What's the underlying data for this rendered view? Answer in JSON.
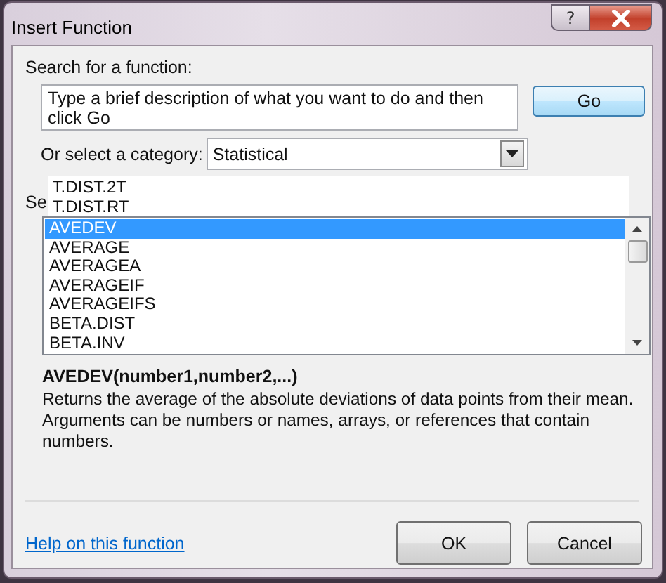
{
  "window": {
    "title": "Insert Function",
    "help_label": "?"
  },
  "search": {
    "label": "Search for a function:",
    "value": "Type a brief description of what you want to do and then click Go",
    "button": "Go"
  },
  "category": {
    "label": "Or select a category:",
    "value": "Statistical"
  },
  "category_popup": {
    "items": [
      "T.DIST.2T",
      "T.DIST.RT"
    ]
  },
  "function_list": {
    "label": "Se",
    "items": [
      {
        "name": "AVEDEV",
        "selected": true
      },
      {
        "name": "AVERAGE",
        "selected": false
      },
      {
        "name": "AVERAGEA",
        "selected": false
      },
      {
        "name": "AVERAGEIF",
        "selected": false
      },
      {
        "name": "AVERAGEIFS",
        "selected": false
      },
      {
        "name": "BETA.DIST",
        "selected": false
      },
      {
        "name": "BETA.INV",
        "selected": false
      }
    ]
  },
  "signature": "AVEDEV(number1,number2,...)",
  "description": "Returns the average of the absolute deviations of data points from their mean. Arguments can be numbers or names, arrays, or references that contain numbers.",
  "help_link": "Help on this function",
  "buttons": [
    "OK",
    "Cancel"
  ]
}
